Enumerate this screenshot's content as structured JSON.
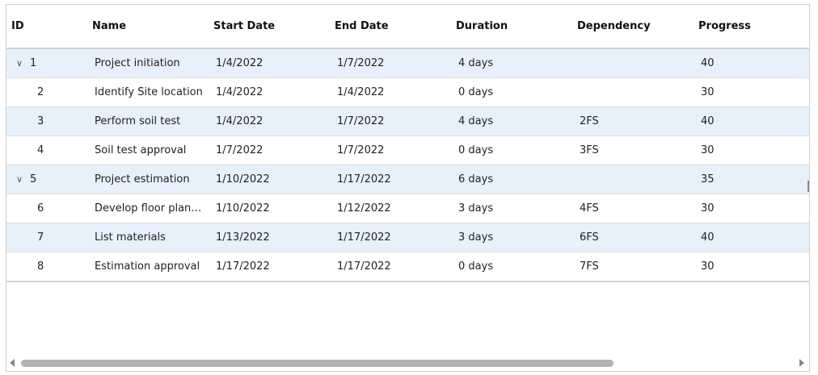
{
  "columns": {
    "id": "ID",
    "name": "Name",
    "start_date": "Start Date",
    "end_date": "End Date",
    "duration": "Duration",
    "dependency": "Dependency",
    "progress": "Progress"
  },
  "icons": {
    "expand": "chevron-down-icon",
    "scroll_left": "arrow-left-icon",
    "scroll_right": "arrow-right-icon"
  },
  "colors": {
    "alt_row": "#e6f1fb",
    "border": "#dcdcdc",
    "scroll_thumb": "#b3b3b3"
  },
  "rows": [
    {
      "id": "1",
      "name": "Project initiation",
      "start": "1/4/2022",
      "end": "1/7/2022",
      "duration": "4 days",
      "dependency": "",
      "progress": "40",
      "expandable": true
    },
    {
      "id": "2",
      "name": "Identify Site location",
      "start": "1/4/2022",
      "end": "1/4/2022",
      "duration": "0 days",
      "dependency": "",
      "progress": "30",
      "expandable": false
    },
    {
      "id": "3",
      "name": "Perform soil test",
      "start": "1/4/2022",
      "end": "1/7/2022",
      "duration": "4 days",
      "dependency": "2FS",
      "progress": "40",
      "expandable": false
    },
    {
      "id": "4",
      "name": "Soil test approval",
      "start": "1/7/2022",
      "end": "1/7/2022",
      "duration": "0 days",
      "dependency": "3FS",
      "progress": "30",
      "expandable": false
    },
    {
      "id": "5",
      "name": "Project estimation",
      "start": "1/10/2022",
      "end": "1/17/2022",
      "duration": "6 days",
      "dependency": "",
      "progress": "35",
      "expandable": true
    },
    {
      "id": "6",
      "name": "Develop floor plan f...",
      "start": "1/10/2022",
      "end": "1/12/2022",
      "duration": "3 days",
      "dependency": "4FS",
      "progress": "30",
      "expandable": false
    },
    {
      "id": "7",
      "name": "List materials",
      "start": "1/13/2022",
      "end": "1/17/2022",
      "duration": "3 days",
      "dependency": "6FS",
      "progress": "40",
      "expandable": false
    },
    {
      "id": "8",
      "name": "Estimation approval",
      "start": "1/17/2022",
      "end": "1/17/2022",
      "duration": "0 days",
      "dependency": "7FS",
      "progress": "30",
      "expandable": false
    }
  ]
}
